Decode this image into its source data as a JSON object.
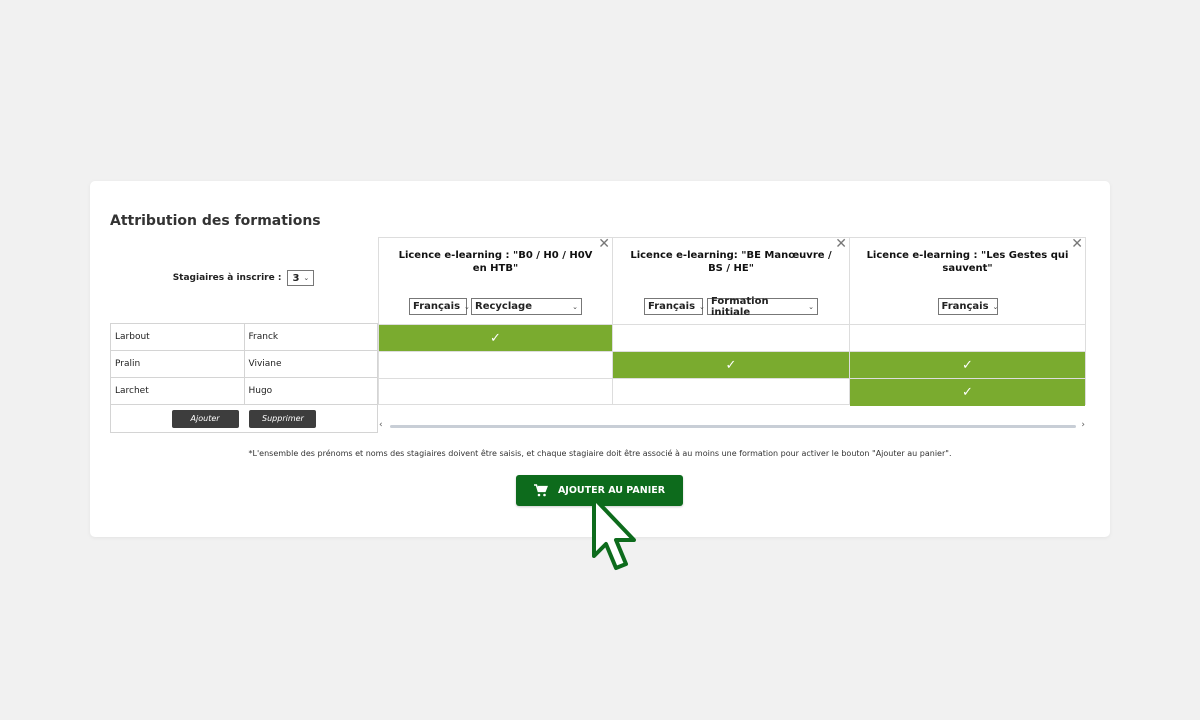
{
  "card": {
    "title": "Attribution des formations",
    "count_label": "Stagiaires à inscrire :",
    "count_value": "3"
  },
  "trainees": [
    {
      "last": "Larbout",
      "first": "Franck"
    },
    {
      "last": "Pralin",
      "first": "Viviane"
    },
    {
      "last": "Larchet",
      "first": "Hugo"
    }
  ],
  "actions": {
    "add": "Ajouter",
    "remove": "Supprimer"
  },
  "formations": [
    {
      "title": "Licence e-learning : \"B0 / H0 / H0V en HTB\"",
      "language": "Français",
      "type": "Recyclage",
      "assigned": [
        true,
        false,
        false
      ]
    },
    {
      "title": "Licence e-learning: \"BE Manœuvre / BS / HE\"",
      "language": "Français",
      "type": "Formation initiale",
      "assigned": [
        false,
        true,
        false
      ]
    },
    {
      "title": "Licence e-learning : \"Les Gestes qui sauvent\"",
      "language": "Français",
      "type": "",
      "assigned": [
        false,
        true,
        true
      ]
    }
  ],
  "icons": {
    "close": "✕",
    "check": "✓",
    "chevron": "⌄",
    "scroll_left": "‹",
    "scroll_right": "›"
  },
  "note": "*L'ensemble des prénoms et noms des stagiaires doivent être saisis, et chaque stagiaire doit être associé à au moins une formation pour activer le bouton \"Ajouter au panier\".",
  "cart_button": "AJOUTER AU PANIER",
  "colors": {
    "assigned": "#7aab2f",
    "cart": "#0d6b1c",
    "cursor": "#0d6b1c"
  }
}
